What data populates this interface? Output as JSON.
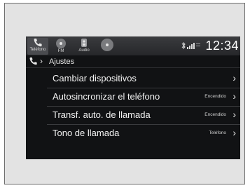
{
  "status_bar": {
    "sources": [
      {
        "label": "Teléfono",
        "icon": "phone-icon",
        "active": true
      },
      {
        "label": "FM",
        "icon": "radio-icon",
        "active": false
      },
      {
        "label": "Audio",
        "icon": "audio-icon",
        "active": false
      },
      {
        "label": "",
        "icon": "disc-icon",
        "active": false
      }
    ],
    "clock": "12:34",
    "indicators": [
      "bluetooth-icon",
      "signal-icon"
    ]
  },
  "breadcrumb": {
    "icon": "phone-icon",
    "title": "Ajustes"
  },
  "menu": {
    "items": [
      {
        "label": "Cambiar dispositivos",
        "value": ""
      },
      {
        "label": "Autosincronizar el teléfono",
        "value": "Encendido"
      },
      {
        "label": "Transf. auto. de llamada",
        "value": "Encendido"
      },
      {
        "label": "Tono de llamada",
        "value": "Teléfono"
      }
    ]
  },
  "colors": {
    "screen_bg": "#111214",
    "statusbar_bg": "#2f3033",
    "text": "#f2f2f2",
    "frame_bg": "#e3e3e3"
  }
}
